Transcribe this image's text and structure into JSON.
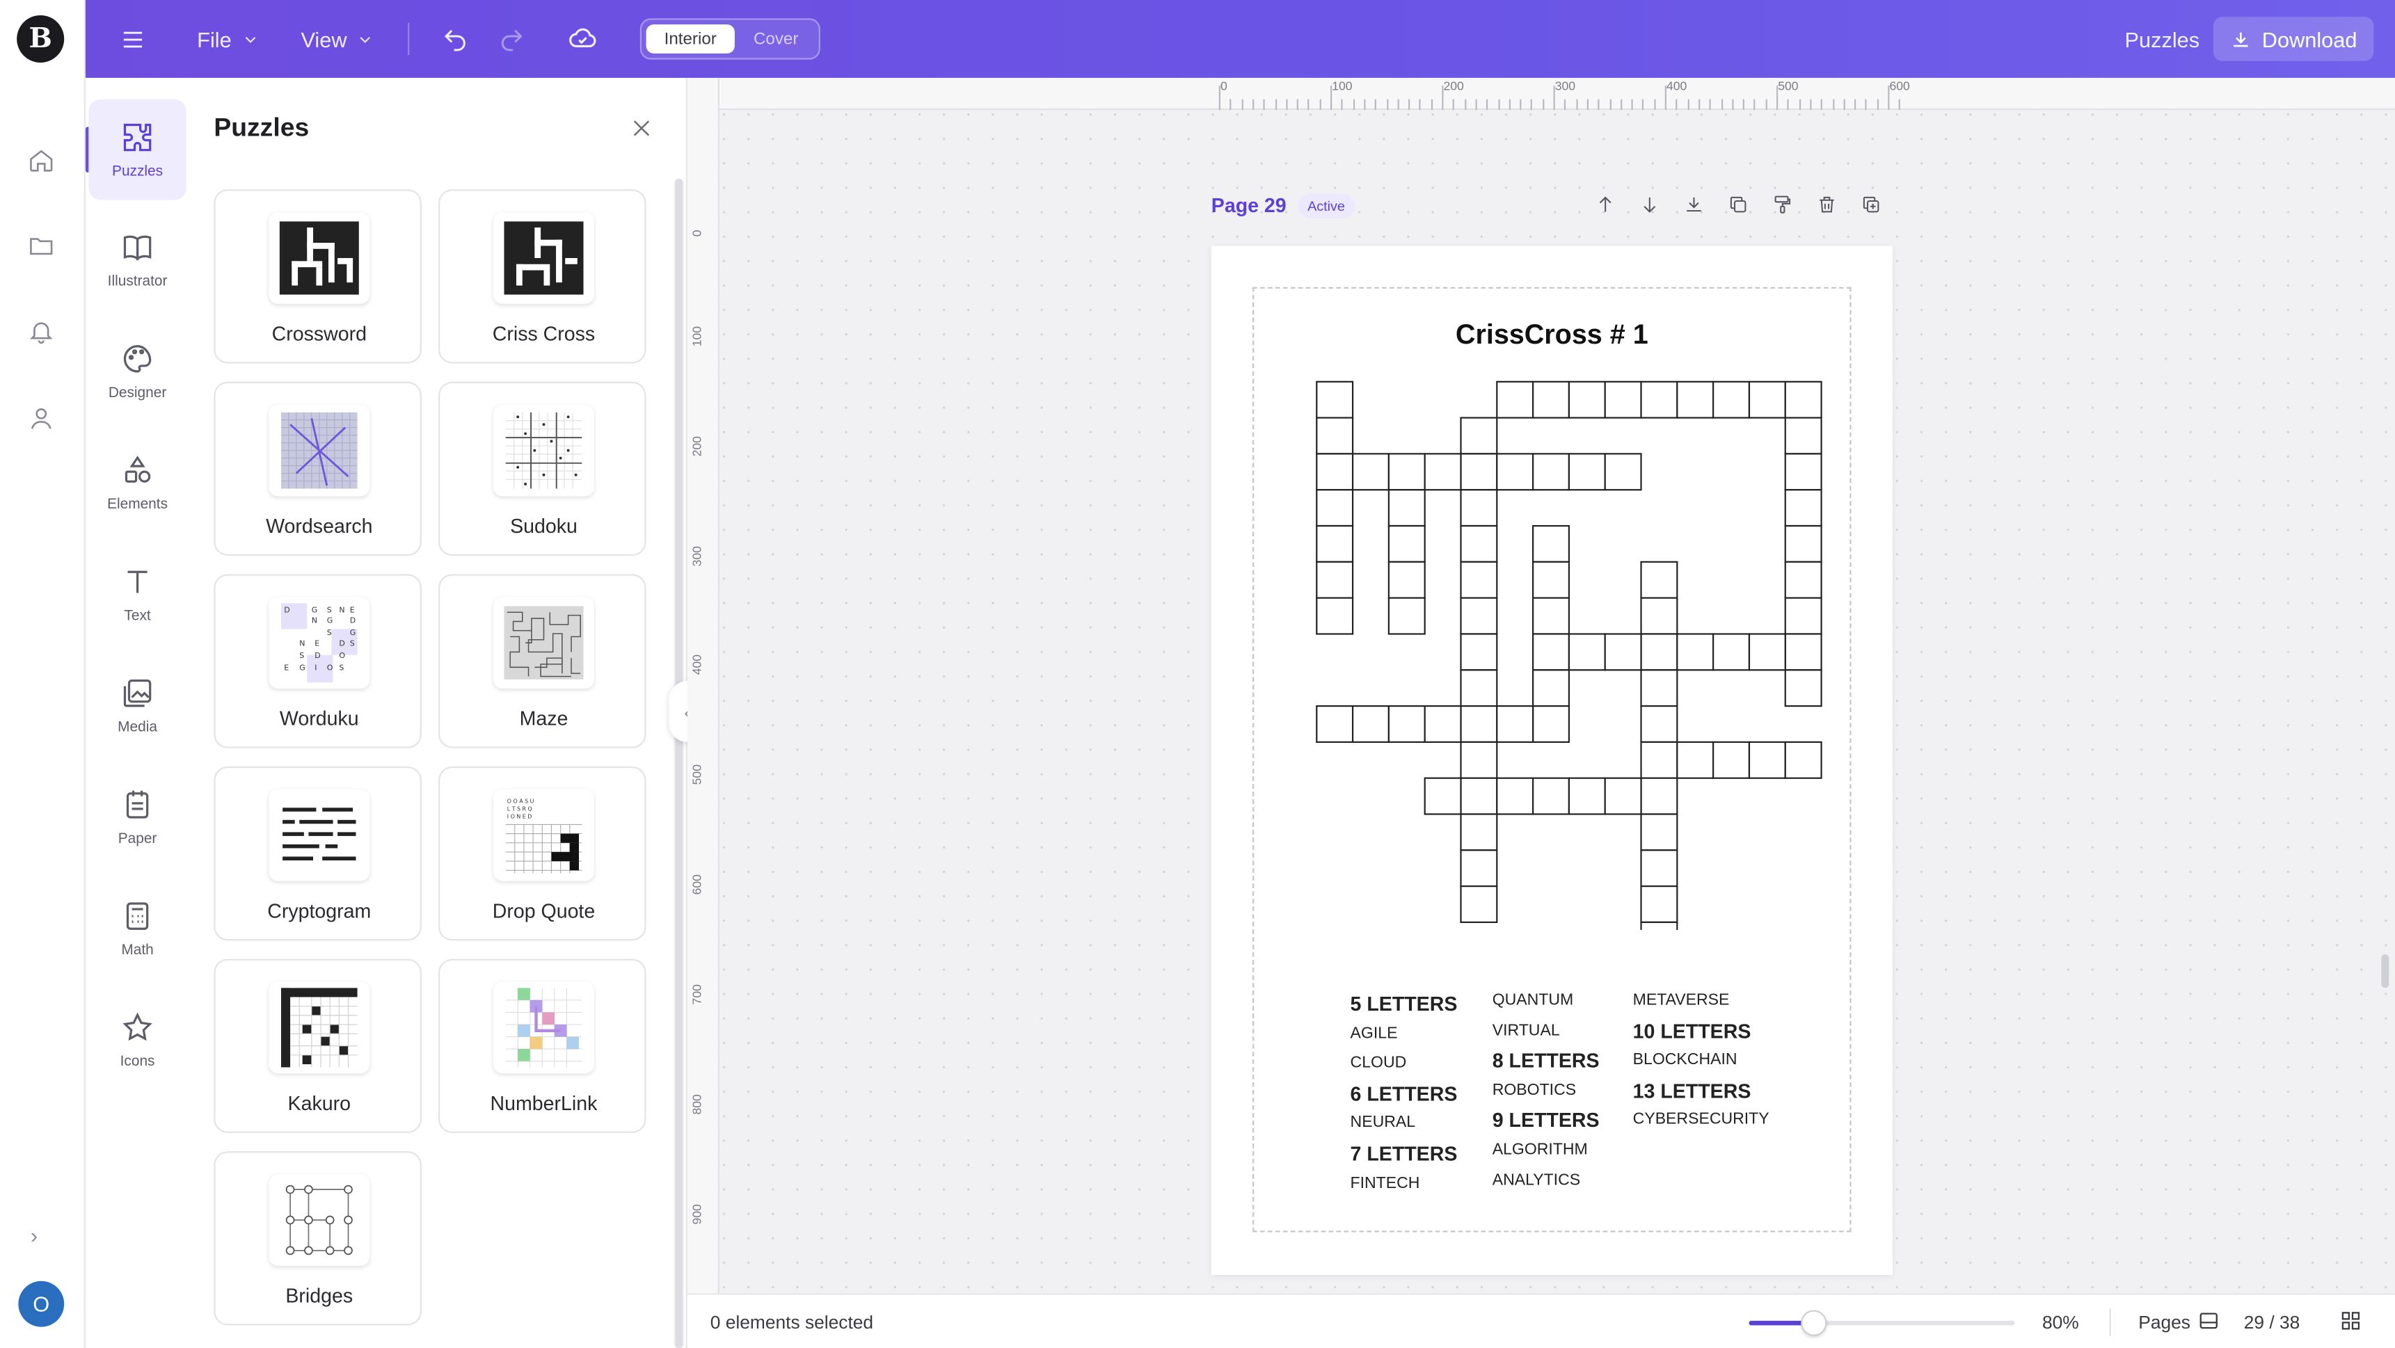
{
  "app": {
    "logo_letter": "B",
    "rail_icons": [
      "home-icon",
      "folder-icon",
      "bell-icon",
      "user-icon"
    ],
    "avatar_letter": "O"
  },
  "topbar": {
    "file_label": "File",
    "view_label": "View",
    "segment": {
      "interior_label": "Interior",
      "cover_label": "Cover",
      "selected": "Interior"
    },
    "puzzles_link": "Puzzles",
    "download_label": "Download",
    "accent": "#6b50e2"
  },
  "tools": [
    {
      "label": "Puzzles",
      "icon": "puzzle-icon",
      "active": true
    },
    {
      "label": "Illustrator",
      "icon": "book-icon",
      "active": false
    },
    {
      "label": "Designer",
      "icon": "palette-icon",
      "active": false
    },
    {
      "label": "Elements",
      "icon": "shapes-icon",
      "active": false
    },
    {
      "label": "Text",
      "icon": "text-icon",
      "active": false
    },
    {
      "label": "Media",
      "icon": "media-icon",
      "active": false
    },
    {
      "label": "Paper",
      "icon": "notepad-icon",
      "active": false
    },
    {
      "label": "Math",
      "icon": "calculator-icon",
      "active": false
    },
    {
      "label": "Icons",
      "icon": "star-icon",
      "active": false
    }
  ],
  "panel": {
    "title": "Puzzles",
    "cards": [
      {
        "label": "Crossword"
      },
      {
        "label": "Criss Cross"
      },
      {
        "label": "Wordsearch"
      },
      {
        "label": "Sudoku"
      },
      {
        "label": "Worduku"
      },
      {
        "label": "Maze"
      },
      {
        "label": "Cryptogram"
      },
      {
        "label": "Drop Quote"
      },
      {
        "label": "Kakuro"
      },
      {
        "label": "NumberLink"
      },
      {
        "label": "Bridges"
      }
    ]
  },
  "ruler": {
    "top": [
      "0",
      "100",
      "200",
      "300",
      "400",
      "500",
      "600"
    ],
    "left": [
      "0",
      "100",
      "200",
      "300",
      "400",
      "500",
      "600",
      "700",
      "800",
      "900"
    ]
  },
  "page": {
    "label": "Page 29",
    "badge": "Active",
    "puzzle_title": "CrissCross # 1",
    "word_columns": [
      [
        {
          "text": "5 LETTERS",
          "header": true
        },
        {
          "text": "AGILE",
          "header": false
        },
        {
          "text": "CLOUD",
          "header": false
        },
        {
          "text": "6 LETTERS",
          "header": true
        },
        {
          "text": "NEURAL",
          "header": false
        },
        {
          "text": "7 LETTERS",
          "header": true
        },
        {
          "text": "FINTECH",
          "header": false
        }
      ],
      [
        {
          "text": "QUANTUM",
          "header": false
        },
        {
          "text": "VIRTUAL",
          "header": false
        },
        {
          "text": "8 LETTERS",
          "header": true
        },
        {
          "text": "ROBOTICS",
          "header": false
        },
        {
          "text": "9 LETTERS",
          "header": true
        },
        {
          "text": "ALGORITHM",
          "header": false
        },
        {
          "text": "ANALYTICS",
          "header": false
        }
      ],
      [
        {
          "text": "METAVERSE",
          "header": false
        },
        {
          "text": "10 LETTERS",
          "header": true
        },
        {
          "text": "BLOCKCHAIN",
          "header": false
        },
        {
          "text": "13 LETTERS",
          "header": true
        },
        {
          "text": "CYBERSECURITY",
          "header": false
        }
      ]
    ]
  },
  "footer": {
    "selection_status": "0 elements selected",
    "zoom": "80%",
    "zoom_fraction": 0.24,
    "pages_label": "Pages",
    "page_counter": "29 / 38"
  }
}
